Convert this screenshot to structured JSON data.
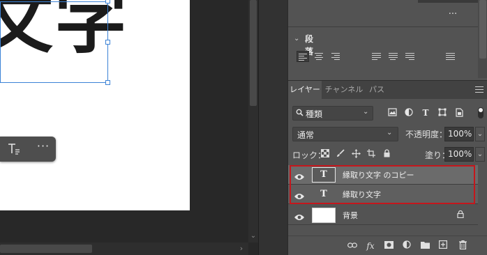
{
  "canvas": {
    "text": "文字",
    "toolbar": {
      "more_label": "···"
    }
  },
  "panel": {
    "top_more_label": "···",
    "paragraph": {
      "title": "段落"
    },
    "tabs": [
      {
        "label": "レイヤー",
        "active": true
      },
      {
        "label": "チャンネル",
        "active": false
      },
      {
        "label": "パス",
        "active": false
      }
    ],
    "filter": {
      "value": "種類"
    },
    "blend_mode": {
      "value": "通常"
    },
    "opacity": {
      "label": "不透明度：",
      "value": "100%"
    },
    "lock": {
      "label": "ロック："
    },
    "fill": {
      "label": "塗り：",
      "value": "100%"
    },
    "layers": [
      {
        "name": "縁取り文字 のコピー",
        "type": "text",
        "selected": true,
        "visible": true
      },
      {
        "name": "縁取り文字",
        "type": "text",
        "selected": true,
        "visible": true
      },
      {
        "name": "背景",
        "type": "background",
        "selected": false,
        "visible": true,
        "locked": true
      }
    ]
  },
  "colors": {
    "panel_bg": "#535353",
    "selection_outline": "#c5161c",
    "bbox": "#3b82d6"
  }
}
